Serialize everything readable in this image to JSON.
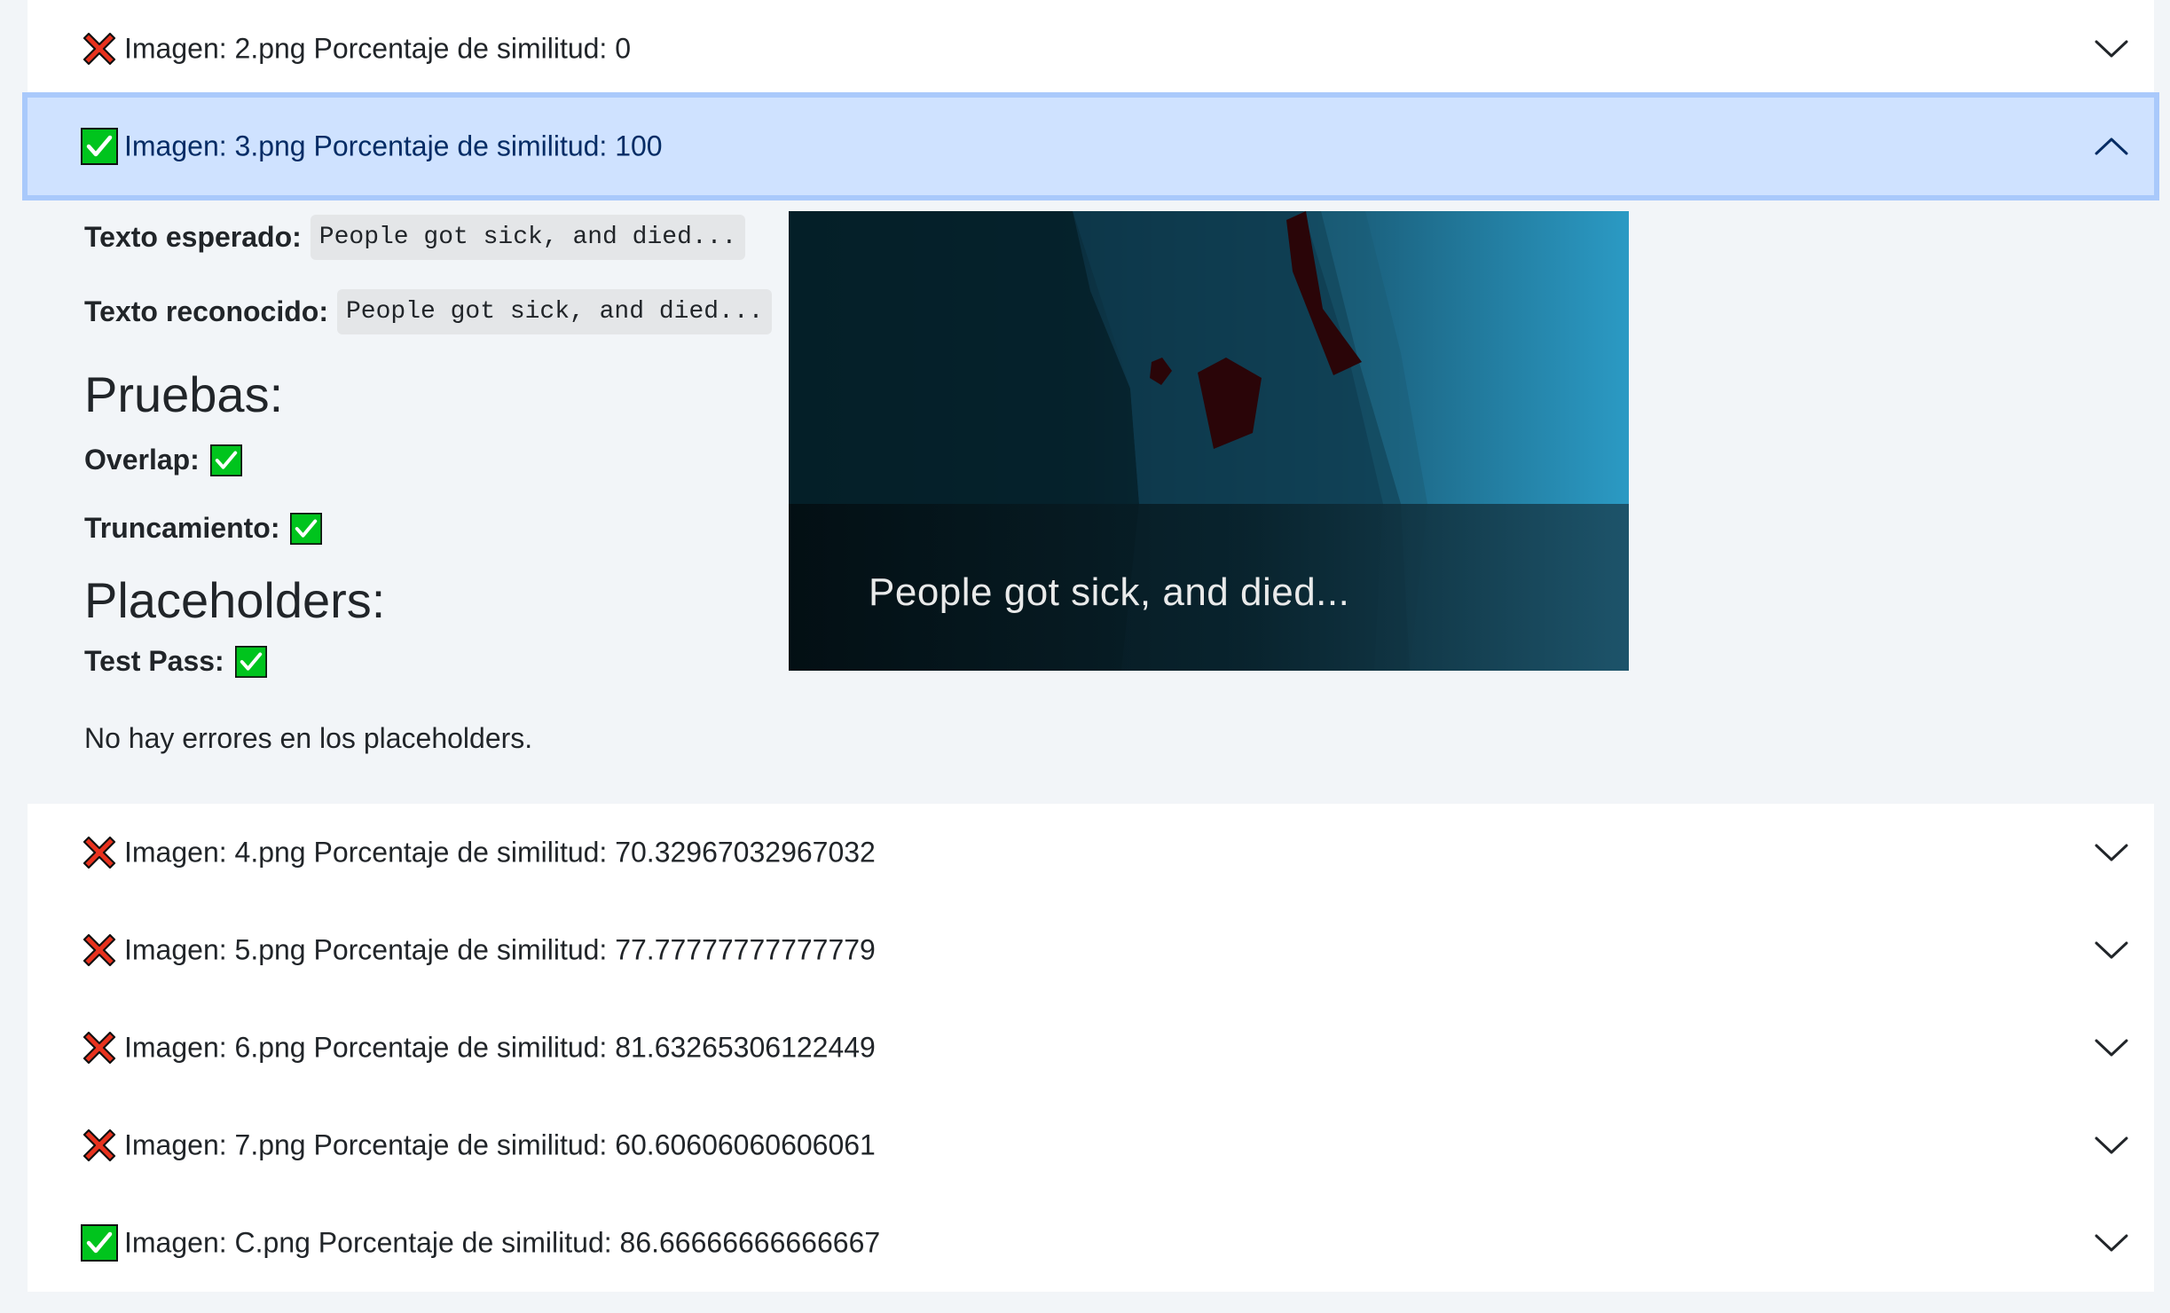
{
  "items": [
    {
      "icon": "cross-icon",
      "label": "Imagen: 2.png Porcentaje de similitud: 0",
      "expanded": false
    },
    {
      "icon": "check-icon",
      "label": "Imagen: 3.png Porcentaje de similitud: 100",
      "expanded": true
    },
    {
      "icon": "cross-icon",
      "label": "Imagen: 4.png Porcentaje de similitud: 70.32967032967032",
      "expanded": false
    },
    {
      "icon": "cross-icon",
      "label": "Imagen: 5.png Porcentaje de similitud: 77.77777777777779",
      "expanded": false
    },
    {
      "icon": "cross-icon",
      "label": "Imagen: 6.png Porcentaje de similitud: 81.63265306122449",
      "expanded": false
    },
    {
      "icon": "cross-icon",
      "label": "Imagen: 7.png Porcentaje de similitud: 60.60606060606061",
      "expanded": false
    },
    {
      "icon": "check-icon",
      "label": "Imagen: C.png Porcentaje de similitud: 86.66666666666667",
      "expanded": false
    }
  ],
  "details": {
    "expected_label": "Texto esperado:",
    "expected_text": "People got sick, and died...",
    "recognized_label": "Texto reconocido:",
    "recognized_text": "People got sick, and died...",
    "tests_title": "Pruebas:",
    "overlap_label": "Overlap:",
    "truncation_label": "Truncamiento:",
    "placeholders_title": "Placeholders:",
    "test_pass_label": "Test Pass:",
    "placeholders_message": "No hay errores en los placeholders.",
    "screenshot_caption": "People got sick, and died..."
  },
  "colors": {
    "check_green": "#00c41d",
    "cross_red": "#e8321e",
    "open_header_bg": "#cfe2ff",
    "open_header_border": "#a9c9fb",
    "page_bg": "#f2f5f8"
  }
}
